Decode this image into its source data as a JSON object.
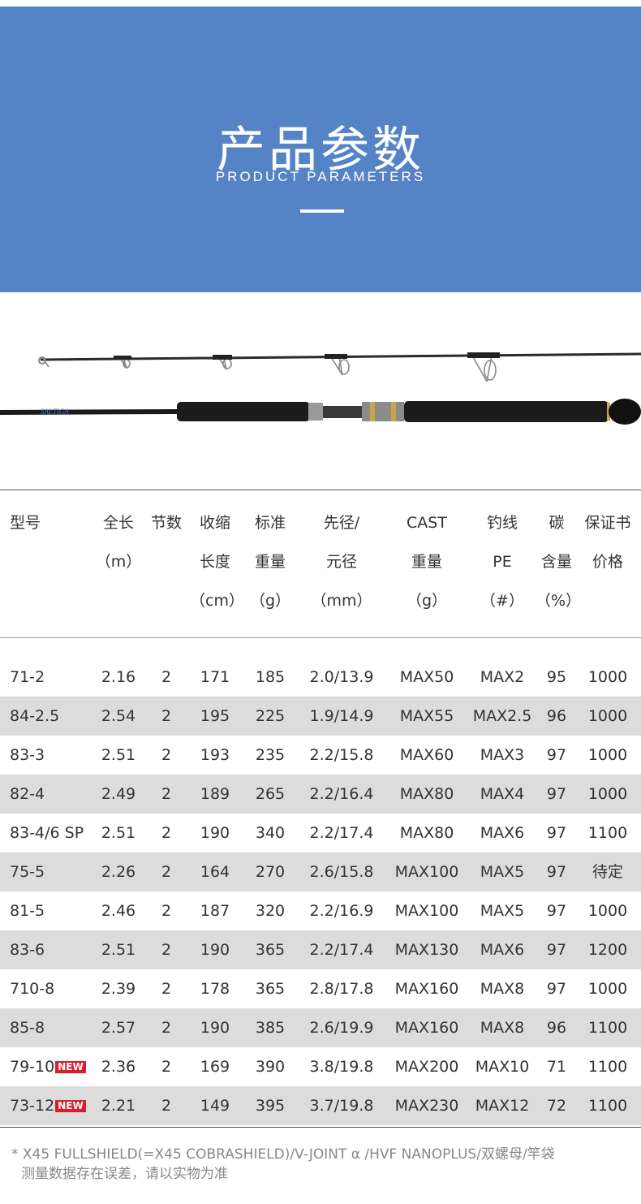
{
  "banner": {
    "title": "产品参数",
    "subtitle": "PRODUCT PARAMETERS",
    "color": "#5484c6"
  },
  "rod_brand": "SALTIGA",
  "table": {
    "headers": [
      [
        "型号"
      ],
      [
        "全长",
        "（m）"
      ],
      [
        "节数"
      ],
      [
        "收缩",
        "长度",
        "（cm）"
      ],
      [
        "标准",
        "重量",
        "（g）"
      ],
      [
        "先径/",
        "元径",
        "（mm）"
      ],
      [
        "CAST",
        "重量",
        "（g）"
      ],
      [
        "钓线",
        "PE",
        "（#）"
      ],
      [
        "碳",
        "含量",
        "（%）"
      ],
      [
        "保证书",
        "价格"
      ]
    ],
    "new_badge": "NEW",
    "rows": [
      {
        "model": "71-2",
        "new": false,
        "length": "2.16",
        "sections": "2",
        "closed": "171",
        "weight": "185",
        "tip_butt": "2.0/13.9",
        "cast": "MAX50",
        "pe": "MAX2",
        "carbon": "95",
        "price": "1000"
      },
      {
        "model": "84-2.5",
        "new": false,
        "length": "2.54",
        "sections": "2",
        "closed": "195",
        "weight": "225",
        "tip_butt": "1.9/14.9",
        "cast": "MAX55",
        "pe": "MAX2.5",
        "carbon": "96",
        "price": "1000"
      },
      {
        "model": "83-3",
        "new": false,
        "length": "2.51",
        "sections": "2",
        "closed": "193",
        "weight": "235",
        "tip_butt": "2.2/15.8",
        "cast": "MAX60",
        "pe": "MAX3",
        "carbon": "97",
        "price": "1000"
      },
      {
        "model": "82-4",
        "new": false,
        "length": "2.49",
        "sections": "2",
        "closed": "189",
        "weight": "265",
        "tip_butt": "2.2/16.4",
        "cast": "MAX80",
        "pe": "MAX4",
        "carbon": "97",
        "price": "1000"
      },
      {
        "model": "83-4/6 SP",
        "new": false,
        "length": "2.51",
        "sections": "2",
        "closed": "190",
        "weight": "340",
        "tip_butt": "2.2/17.4",
        "cast": "MAX80",
        "pe": "MAX6",
        "carbon": "97",
        "price": "1100"
      },
      {
        "model": "75-5",
        "new": false,
        "length": "2.26",
        "sections": "2",
        "closed": "164",
        "weight": "270",
        "tip_butt": "2.6/15.8",
        "cast": "MAX100",
        "pe": "MAX5",
        "carbon": "97",
        "price": "待定"
      },
      {
        "model": "81-5",
        "new": false,
        "length": "2.46",
        "sections": "2",
        "closed": "187",
        "weight": "320",
        "tip_butt": "2.2/16.9",
        "cast": "MAX100",
        "pe": "MAX5",
        "carbon": "97",
        "price": "1000"
      },
      {
        "model": "83-6",
        "new": false,
        "length": "2.51",
        "sections": "2",
        "closed": "190",
        "weight": "365",
        "tip_butt": "2.2/17.4",
        "cast": "MAX130",
        "pe": "MAX6",
        "carbon": "97",
        "price": "1200"
      },
      {
        "model": "710-8",
        "new": false,
        "length": "2.39",
        "sections": "2",
        "closed": "178",
        "weight": "365",
        "tip_butt": "2.8/17.8",
        "cast": "MAX160",
        "pe": "MAX8",
        "carbon": "97",
        "price": "1000"
      },
      {
        "model": "85-8",
        "new": false,
        "length": "2.57",
        "sections": "2",
        "closed": "190",
        "weight": "385",
        "tip_butt": "2.6/19.9",
        "cast": "MAX160",
        "pe": "MAX8",
        "carbon": "96",
        "price": "1100"
      },
      {
        "model": "79-10",
        "new": true,
        "length": "2.36",
        "sections": "2",
        "closed": "169",
        "weight": "390",
        "tip_butt": "3.8/19.8",
        "cast": "MAX200",
        "pe": "MAX10",
        "carbon": "71",
        "price": "1100"
      },
      {
        "model": "73-12",
        "new": true,
        "length": "2.21",
        "sections": "2",
        "closed": "149",
        "weight": "395",
        "tip_butt": "3.7/19.8",
        "cast": "MAX230",
        "pe": "MAX12",
        "carbon": "72",
        "price": "1100"
      }
    ]
  },
  "footnote": {
    "line1": "* X45 FULLSHIELD(=X45 COBRASHIELD)/V-JOINT α /HVF NANOPLUS/双螺母/竿袋",
    "line2": "测量数据存在误差，请以实物为准"
  }
}
